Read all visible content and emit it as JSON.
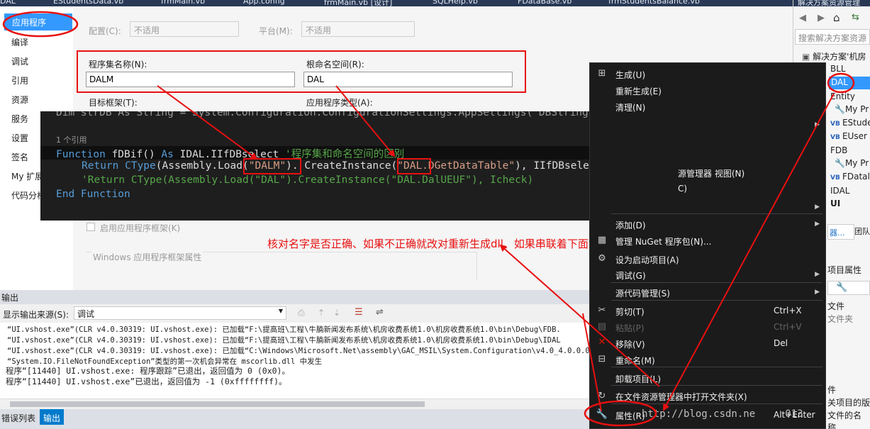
{
  "tabs": [
    "EStudentsData.vb",
    "frmMain.vb",
    "App.config",
    "frmMain.vb [设计]",
    "SQLHelp.vb",
    "FDataBase.vb",
    "frmStudentsBalance.vb"
  ],
  "left_nav": [
    "应用程序",
    "编译",
    "调试",
    "引用",
    "资源",
    "服务",
    "设置",
    "签名",
    "My 扩展",
    "代码分析"
  ],
  "config": {
    "config_label": "配置(C):",
    "config_value": "不适用",
    "platform_label": "平台(M):",
    "platform_value": "不适用"
  },
  "assembly": {
    "name_label": "程序集名称(N):",
    "name_value": "DALM",
    "ns_label": "根命名空间(R):",
    "ns_value": "DAL",
    "framework_label": "目标框架(T):",
    "apptype_label": "应用程序类型(A):"
  },
  "framework": {
    "enable_label": "启用应用程序框架(K)",
    "group_label": "Windows 应用程序框架属性"
  },
  "code": {
    "line0": "Dim strDB As String = System.Configuration.ConfigurationSettings.AppSettings(\"DBString\")",
    "refs": "1 个引用",
    "l1_kw": "Function",
    "l1_name": " fDBif() ",
    "l1_as": "As",
    "l1_type": " IDAL.IIfDBselect",
    "l1_cm": " '程序集和命名空间的区别",
    "l2_ret": "Return",
    "l2_ctype": " CType",
    "l2_a": "(Assembly.Load(",
    "l2_s1": "\"DALM\"",
    "l2_b": "). CreateInstance(",
    "l2_s2": "\"DAL.DGetDataTable\"",
    "l2_c": "), IIfDBselect)",
    "l3": "'Return CType(Assembly.Load(\"DAL\").CreateInstance(\"DAL.DalUEUF\"), Icheck)",
    "l4_end": "End",
    "l4_fn": " Function"
  },
  "annotation": "核对名字是否正确、如果不正确就改对重新生成dll、如果串联着下面的",
  "output": {
    "title": "输出",
    "source_label": "显示输出来源(S):",
    "source_value": "调试",
    "lines": [
      "“UI.vshost.exe”(CLR v4.0.30319: UI.vshost.exe):  已加载“F:\\提高班\\工程\\牛腩新闻发布系统\\机房收费系统1.0\\机房收费系统1.0\\bin\\Debug\\FDB.",
      "“UI.vshost.exe”(CLR v4.0.30319: UI.vshost.exe):  已加载“F:\\提高班\\工程\\牛腩新闻发布系统\\机房收费系统1.0\\机房收费系统1.0\\bin\\Debug\\IDAL",
      "“UI.vshost.exe”(CLR v4.0.30319: UI.vshost.exe):  已加载“C:\\Windows\\Microsoft.Net\\assembly\\GAC_MSIL\\System.Configuration\\v4.0_4.0.0.0__",
      "“System.IO.FileNotFoundException”类型的第一次机会异常在 mscorlib.dll 中发生",
      "程序“[11440] UI.vshost.exe: 程序跟踪”已退出，返回值为 0 (0x0)。",
      "程序“[11440] UI.vshost.exe”已退出，返回值为 -1 (0xffffffff)。"
    ]
  },
  "bottom_tabs": [
    "错误列表",
    "输出"
  ],
  "solution_explorer": {
    "title": "解决方案资源管理",
    "search_placeholder": "搜索解决方案资源",
    "items": [
      "解决方案'机房",
      "BLL",
      "DAL",
      "Entity",
      "My Pr",
      "EStude",
      "EUser",
      "FDB",
      "My Pr",
      "FDatal",
      "IDAL",
      "UI"
    ],
    "tabs": [
      "器...",
      "团队"
    ],
    "props_title": "项目属性",
    "props_rows": [
      "文件",
      "文件夹"
    ],
    "bottom_rows": [
      "件",
      "关项目的版",
      "文件的名称,"
    ]
  },
  "context_menu": {
    "items": [
      {
        "label": "生成(U)"
      },
      {
        "label": "重新生成(E)"
      },
      {
        "label": "清理(N)"
      },
      {
        "label": "源管理器 视图(N)"
      },
      {
        "label": "C)"
      },
      {
        "label": "添加(D)"
      },
      {
        "label": "管理 NuGet 程序包(N)..."
      },
      {
        "label": "设为启动项目(A)"
      },
      {
        "label": "调试(G)"
      },
      {
        "label": "源代码管理(S)"
      },
      {
        "label": "剪切(T)",
        "shortcut": "Ctrl+X"
      },
      {
        "label": "粘贴(P)",
        "shortcut": "Ctrl+V"
      },
      {
        "label": "移除(V)",
        "shortcut": "Del"
      },
      {
        "label": "重命名(M)"
      },
      {
        "label": "卸载项目(L)"
      },
      {
        "label": "在文件资源管理器中打开文件夹(X)"
      },
      {
        "label": "属性(R)",
        "shortcut": "Alt+Enter"
      }
    ]
  },
  "watermark": "http://blog.csdn.ne     013"
}
